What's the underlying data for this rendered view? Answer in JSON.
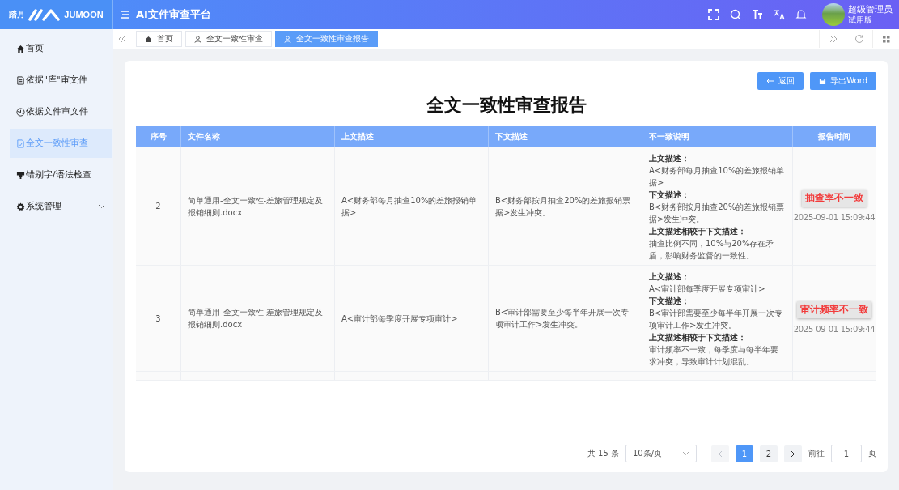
{
  "logo": {
    "brand_cn": "踏月",
    "brand_en": "JUMOON"
  },
  "header": {
    "title": "AI文件审查平台",
    "user": {
      "name": "超级管理员",
      "role": "试用版"
    }
  },
  "sidebar": {
    "items": [
      {
        "label": "首页",
        "selected": false,
        "expandable": false
      },
      {
        "label": "依据\"库\"审文件",
        "selected": false,
        "expandable": false
      },
      {
        "label": "依据文件审文件",
        "selected": false,
        "expandable": false
      },
      {
        "label": "全文一致性审查",
        "selected": true,
        "expandable": false
      },
      {
        "label": "错别字/语法检查",
        "selected": false,
        "expandable": false
      },
      {
        "label": "系统管理",
        "selected": false,
        "expandable": true
      }
    ]
  },
  "tabs": [
    {
      "label": "首页",
      "selected": false
    },
    {
      "label": "全文一致性审查",
      "selected": false
    },
    {
      "label": "全文一致性审查报告",
      "selected": true
    }
  ],
  "report": {
    "title": "全文一致性审查报告",
    "buttons": [
      {
        "label": "返回",
        "kind": "back"
      },
      {
        "label": "导出Word",
        "kind": "export"
      }
    ],
    "columns": [
      "序号",
      "文件名称",
      "上文描述",
      "下文描述",
      "不一致说明",
      "报告时间"
    ],
    "rows": [
      {
        "index": "2",
        "file": "简单通用-全文一致性-差旅管理规定及报销细则.docx",
        "upper": "A<财务部每月抽查10%的差旅报销单据>",
        "lower": "B<财务部按月抽查20%的差旅报销票据>发生冲突。",
        "explanation": [
          {
            "heading": "上文描述：",
            "text": "A<财务部每月抽查10%的差旅报销单据>"
          },
          {
            "heading": "下文描述：",
            "text": "B<财务部按月抽查20%的差旅报销票据>发生冲突。"
          },
          {
            "heading": "上文描述相较于下文描述：",
            "text": "抽查比例不同，10%与20%存在矛盾，影响财务监督的一致性。"
          }
        ],
        "time": "2025-09-01 15:09:44",
        "callout": "抽查率不一致"
      },
      {
        "index": "3",
        "file": "简单通用-全文一致性-差旅管理规定及报销细则.docx",
        "upper": "A<审计部每季度开展专项审计>",
        "lower": "B<审计部需要至少每半年开展一次专项审计工作>发生冲突。",
        "explanation": [
          {
            "heading": "上文描述：",
            "text": "A<审计部每季度开展专项审计>"
          },
          {
            "heading": "下文描述：",
            "text": "B<审计部需要至少每半年开展一次专项审计工作>发生冲突。"
          },
          {
            "heading": "上文描述相较于下文描述：",
            "text": "审计频率不一致，每季度与每半年要求冲突，导致审计计划混乱。"
          }
        ],
        "time": "2025-09-01 15:09:44",
        "callout": "审计频率不一致"
      }
    ]
  },
  "pagination": {
    "total": "共 15 条",
    "page_size": "10条/页",
    "prev_disabled": true,
    "next_disabled": false,
    "pages": [
      {
        "label": "1",
        "selected": true
      },
      {
        "label": "2",
        "selected": false
      }
    ],
    "goto_label": "前往",
    "goto_value": "1",
    "page_suffix": "页"
  }
}
